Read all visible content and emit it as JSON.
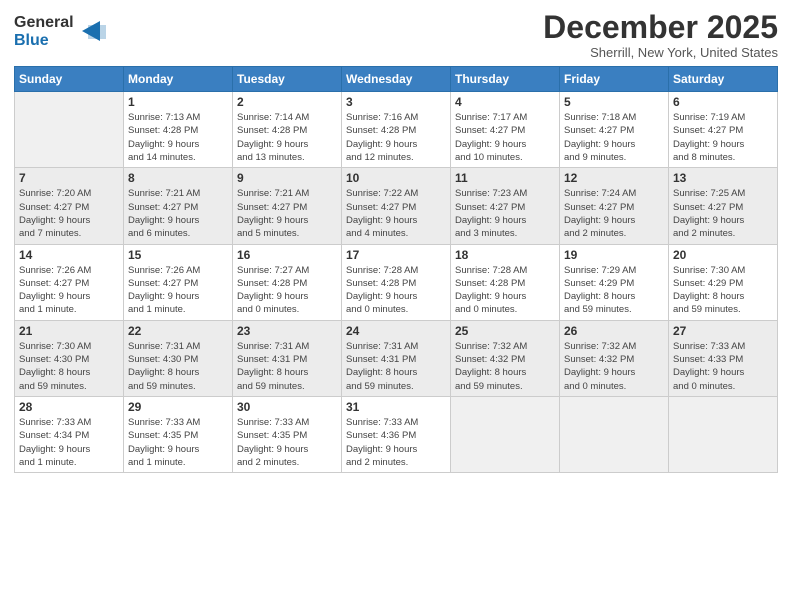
{
  "logo": {
    "general": "General",
    "blue": "Blue"
  },
  "title": "December 2025",
  "location": "Sherrill, New York, United States",
  "days_of_week": [
    "Sunday",
    "Monday",
    "Tuesday",
    "Wednesday",
    "Thursday",
    "Friday",
    "Saturday"
  ],
  "weeks": [
    [
      {
        "day": "",
        "info": ""
      },
      {
        "day": "1",
        "info": "Sunrise: 7:13 AM\nSunset: 4:28 PM\nDaylight: 9 hours\nand 14 minutes."
      },
      {
        "day": "2",
        "info": "Sunrise: 7:14 AM\nSunset: 4:28 PM\nDaylight: 9 hours\nand 13 minutes."
      },
      {
        "day": "3",
        "info": "Sunrise: 7:16 AM\nSunset: 4:28 PM\nDaylight: 9 hours\nand 12 minutes."
      },
      {
        "day": "4",
        "info": "Sunrise: 7:17 AM\nSunset: 4:27 PM\nDaylight: 9 hours\nand 10 minutes."
      },
      {
        "day": "5",
        "info": "Sunrise: 7:18 AM\nSunset: 4:27 PM\nDaylight: 9 hours\nand 9 minutes."
      },
      {
        "day": "6",
        "info": "Sunrise: 7:19 AM\nSunset: 4:27 PM\nDaylight: 9 hours\nand 8 minutes."
      }
    ],
    [
      {
        "day": "7",
        "info": "Sunrise: 7:20 AM\nSunset: 4:27 PM\nDaylight: 9 hours\nand 7 minutes."
      },
      {
        "day": "8",
        "info": "Sunrise: 7:21 AM\nSunset: 4:27 PM\nDaylight: 9 hours\nand 6 minutes."
      },
      {
        "day": "9",
        "info": "Sunrise: 7:21 AM\nSunset: 4:27 PM\nDaylight: 9 hours\nand 5 minutes."
      },
      {
        "day": "10",
        "info": "Sunrise: 7:22 AM\nSunset: 4:27 PM\nDaylight: 9 hours\nand 4 minutes."
      },
      {
        "day": "11",
        "info": "Sunrise: 7:23 AM\nSunset: 4:27 PM\nDaylight: 9 hours\nand 3 minutes."
      },
      {
        "day": "12",
        "info": "Sunrise: 7:24 AM\nSunset: 4:27 PM\nDaylight: 9 hours\nand 2 minutes."
      },
      {
        "day": "13",
        "info": "Sunrise: 7:25 AM\nSunset: 4:27 PM\nDaylight: 9 hours\nand 2 minutes."
      }
    ],
    [
      {
        "day": "14",
        "info": "Sunrise: 7:26 AM\nSunset: 4:27 PM\nDaylight: 9 hours\nand 1 minute."
      },
      {
        "day": "15",
        "info": "Sunrise: 7:26 AM\nSunset: 4:27 PM\nDaylight: 9 hours\nand 1 minute."
      },
      {
        "day": "16",
        "info": "Sunrise: 7:27 AM\nSunset: 4:28 PM\nDaylight: 9 hours\nand 0 minutes."
      },
      {
        "day": "17",
        "info": "Sunrise: 7:28 AM\nSunset: 4:28 PM\nDaylight: 9 hours\nand 0 minutes."
      },
      {
        "day": "18",
        "info": "Sunrise: 7:28 AM\nSunset: 4:28 PM\nDaylight: 9 hours\nand 0 minutes."
      },
      {
        "day": "19",
        "info": "Sunrise: 7:29 AM\nSunset: 4:29 PM\nDaylight: 8 hours\nand 59 minutes."
      },
      {
        "day": "20",
        "info": "Sunrise: 7:30 AM\nSunset: 4:29 PM\nDaylight: 8 hours\nand 59 minutes."
      }
    ],
    [
      {
        "day": "21",
        "info": "Sunrise: 7:30 AM\nSunset: 4:30 PM\nDaylight: 8 hours\nand 59 minutes."
      },
      {
        "day": "22",
        "info": "Sunrise: 7:31 AM\nSunset: 4:30 PM\nDaylight: 8 hours\nand 59 minutes."
      },
      {
        "day": "23",
        "info": "Sunrise: 7:31 AM\nSunset: 4:31 PM\nDaylight: 8 hours\nand 59 minutes."
      },
      {
        "day": "24",
        "info": "Sunrise: 7:31 AM\nSunset: 4:31 PM\nDaylight: 8 hours\nand 59 minutes."
      },
      {
        "day": "25",
        "info": "Sunrise: 7:32 AM\nSunset: 4:32 PM\nDaylight: 8 hours\nand 59 minutes."
      },
      {
        "day": "26",
        "info": "Sunrise: 7:32 AM\nSunset: 4:32 PM\nDaylight: 9 hours\nand 0 minutes."
      },
      {
        "day": "27",
        "info": "Sunrise: 7:33 AM\nSunset: 4:33 PM\nDaylight: 9 hours\nand 0 minutes."
      }
    ],
    [
      {
        "day": "28",
        "info": "Sunrise: 7:33 AM\nSunset: 4:34 PM\nDaylight: 9 hours\nand 1 minute."
      },
      {
        "day": "29",
        "info": "Sunrise: 7:33 AM\nSunset: 4:35 PM\nDaylight: 9 hours\nand 1 minute."
      },
      {
        "day": "30",
        "info": "Sunrise: 7:33 AM\nSunset: 4:35 PM\nDaylight: 9 hours\nand 2 minutes."
      },
      {
        "day": "31",
        "info": "Sunrise: 7:33 AM\nSunset: 4:36 PM\nDaylight: 9 hours\nand 2 minutes."
      },
      {
        "day": "",
        "info": ""
      },
      {
        "day": "",
        "info": ""
      },
      {
        "day": "",
        "info": ""
      }
    ]
  ]
}
